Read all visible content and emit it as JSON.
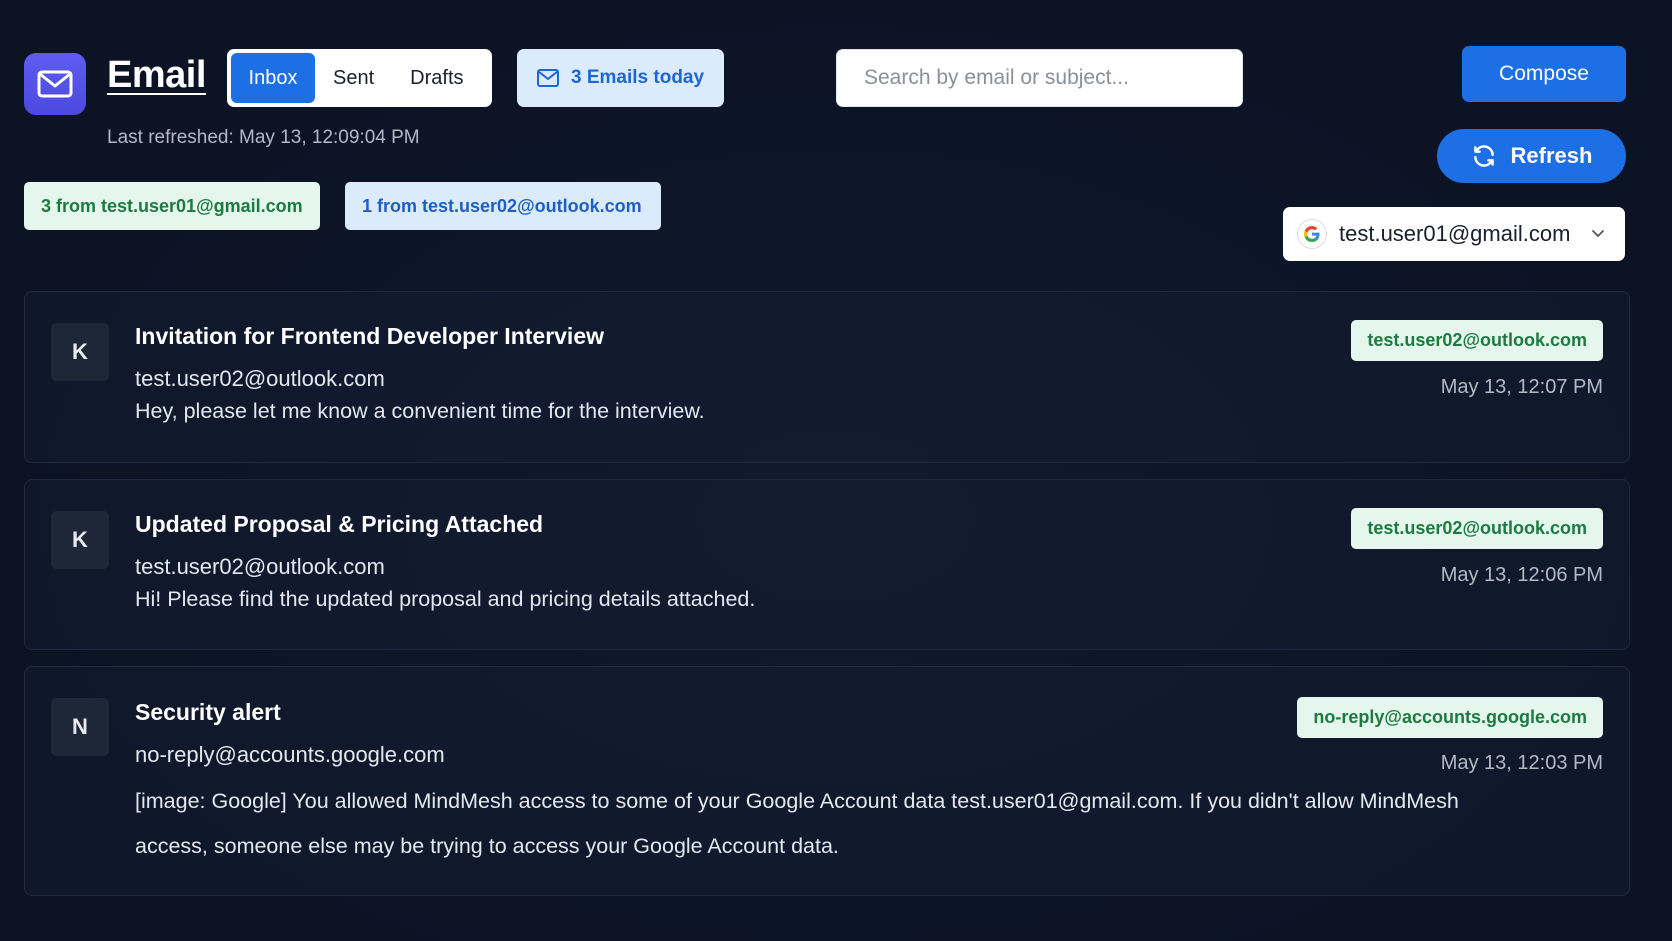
{
  "app": {
    "title": "Email",
    "last_refreshed": "Last refreshed: May 13, 12:09:04 PM"
  },
  "tabs": [
    {
      "label": "Inbox",
      "active": true
    },
    {
      "label": "Sent",
      "active": false
    },
    {
      "label": "Drafts",
      "active": false
    }
  ],
  "emails_today": "3 Emails today",
  "search": {
    "placeholder": "Search by email or subject...",
    "value": ""
  },
  "buttons": {
    "compose": "Compose",
    "refresh": "Refresh"
  },
  "account": {
    "selected": "test.user01@gmail.com",
    "icon": "google-icon"
  },
  "chips": [
    {
      "label": "3 from test.user01@gmail.com",
      "color": "#e5f7ec"
    },
    {
      "label": "1 from test.user02@outlook.com",
      "color": "#dcebfb"
    }
  ],
  "emails": [
    {
      "initial": "K",
      "subject": "Invitation for Frontend Developer Interview",
      "from": "test.user02@outlook.com",
      "preview": "Hey, please let me know a convenient time for the interview.",
      "badge": "test.user02@outlook.com",
      "time": "May 13, 12:07 PM"
    },
    {
      "initial": "K",
      "subject": "Updated Proposal & Pricing Attached",
      "from": "test.user02@outlook.com",
      "preview": "Hi! Please find the updated proposal and pricing details attached.",
      "badge": "test.user02@outlook.com",
      "time": "May 13, 12:06 PM"
    },
    {
      "initial": "N",
      "subject": "Security alert",
      "from": "no-reply@accounts.google.com",
      "preview": "[image: Google] You allowed MindMesh access to some of your Google Account data test.user01@gmail.com. If you didn't allow MindMesh access, someone else may be trying to access your Google Account data.",
      "badge": "no-reply@accounts.google.com",
      "time": "May 13, 12:03 PM"
    }
  ],
  "colors": {
    "accent": "#1d6fe5",
    "background": "#0c1427",
    "logo": "#5653e8"
  }
}
